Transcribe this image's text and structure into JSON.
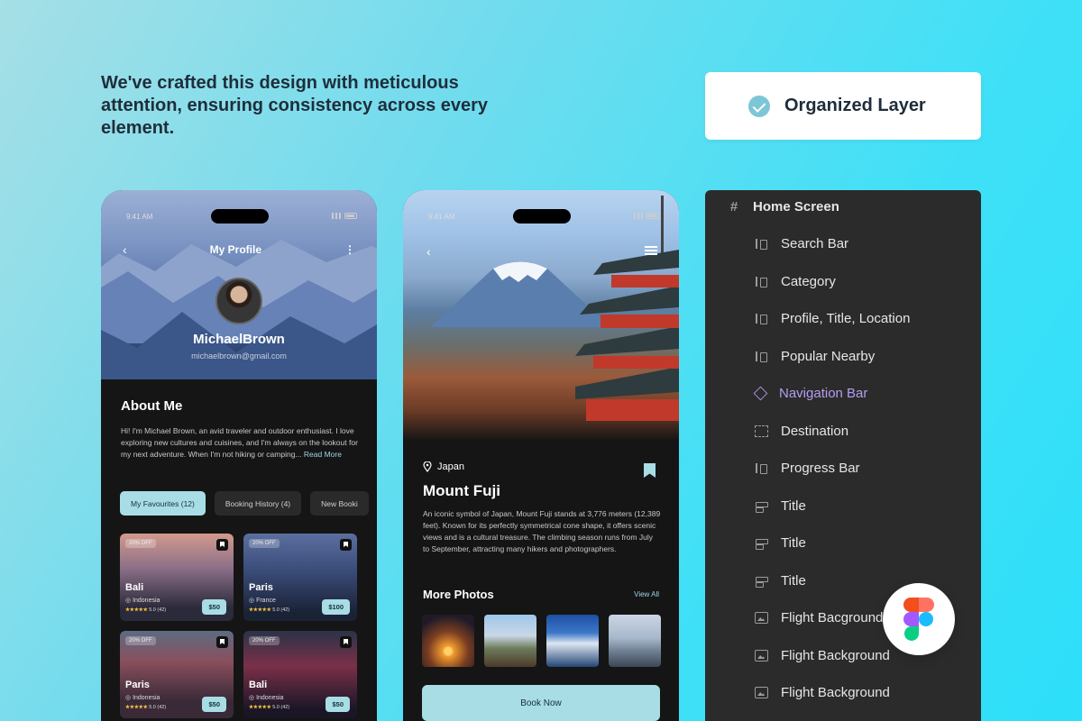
{
  "headline": "We've crafted this design with meticulous attention, ensuring consistency across every element.",
  "badge": {
    "label": "Organized Layer",
    "icon": "check-circle-icon"
  },
  "profile_screen": {
    "time": "9:41 AM",
    "title": "My Profile",
    "name": "MichaelBrown",
    "email": "michaelbrown@gmail.com",
    "about_heading": "About Me",
    "about_text": "Hi! I'm Michael Brown, an avid traveler and outdoor enthusiast. I love exploring new cultures and cuisines, and I'm always on the lookout for my next adventure. When I'm not hiking or camping...",
    "read_more": "Read More",
    "tabs": [
      "My Favourites (12)",
      "Booking History (4)",
      "New Booki"
    ],
    "cards": [
      {
        "discount": "20% OFF",
        "name": "Bali",
        "location": "Indonesia",
        "stars": "★★★★★",
        "rating": "5.0 (42)",
        "price": "$50"
      },
      {
        "discount": "20% OFF",
        "name": "Paris",
        "location": "France",
        "stars": "★★★★★",
        "rating": "5.0 (42)",
        "price": "$100"
      },
      {
        "discount": "20% OFF",
        "name": "Paris",
        "location": "Indonesia",
        "stars": "★★★★★",
        "rating": "5.0 (42)",
        "price": "$50"
      },
      {
        "discount": "20% OFF",
        "name": "Bali",
        "location": "Indonesia",
        "stars": "★★★★★",
        "rating": "5.0 (42)",
        "price": "$50"
      }
    ]
  },
  "detail_screen": {
    "time": "9:41 AM",
    "location": "Japan",
    "title": "Mount Fuji",
    "description": "An iconic symbol of Japan, Mount Fuji stands at 3,776 meters (12,389 feet). Known for its perfectly symmetrical cone shape, it offers scenic views and is a cultural treasure. The climbing season runs from July to September, attracting many hikers and photographers.",
    "more_photos": "More Photos",
    "view_all": "View All",
    "book_now": "Book Now"
  },
  "layers": {
    "root": "Home Screen",
    "items": [
      {
        "label": "Search Bar",
        "icon": "auto-layout-icon"
      },
      {
        "label": "Category",
        "icon": "auto-layout-icon"
      },
      {
        "label": "Profile, Title, Location",
        "icon": "auto-layout-icon"
      },
      {
        "label": "Popular Nearby",
        "icon": "auto-layout-icon"
      },
      {
        "label": "Navigation Bar",
        "icon": "component-icon"
      },
      {
        "label": "Destination",
        "icon": "frame-icon"
      },
      {
        "label": "Progress Bar",
        "icon": "auto-layout-icon"
      },
      {
        "label": "Title",
        "icon": "text-icon"
      },
      {
        "label": "Title",
        "icon": "text-icon"
      },
      {
        "label": "Title",
        "icon": "text-icon"
      },
      {
        "label": "Flight Bacground",
        "icon": "image-icon"
      },
      {
        "label": "Flight Background",
        "icon": "image-icon"
      },
      {
        "label": "Flight Background",
        "icon": "image-icon"
      }
    ]
  },
  "colors": {
    "accent": "#a8dde6",
    "panel": "#2b2b2b",
    "component": "#b49df0"
  }
}
